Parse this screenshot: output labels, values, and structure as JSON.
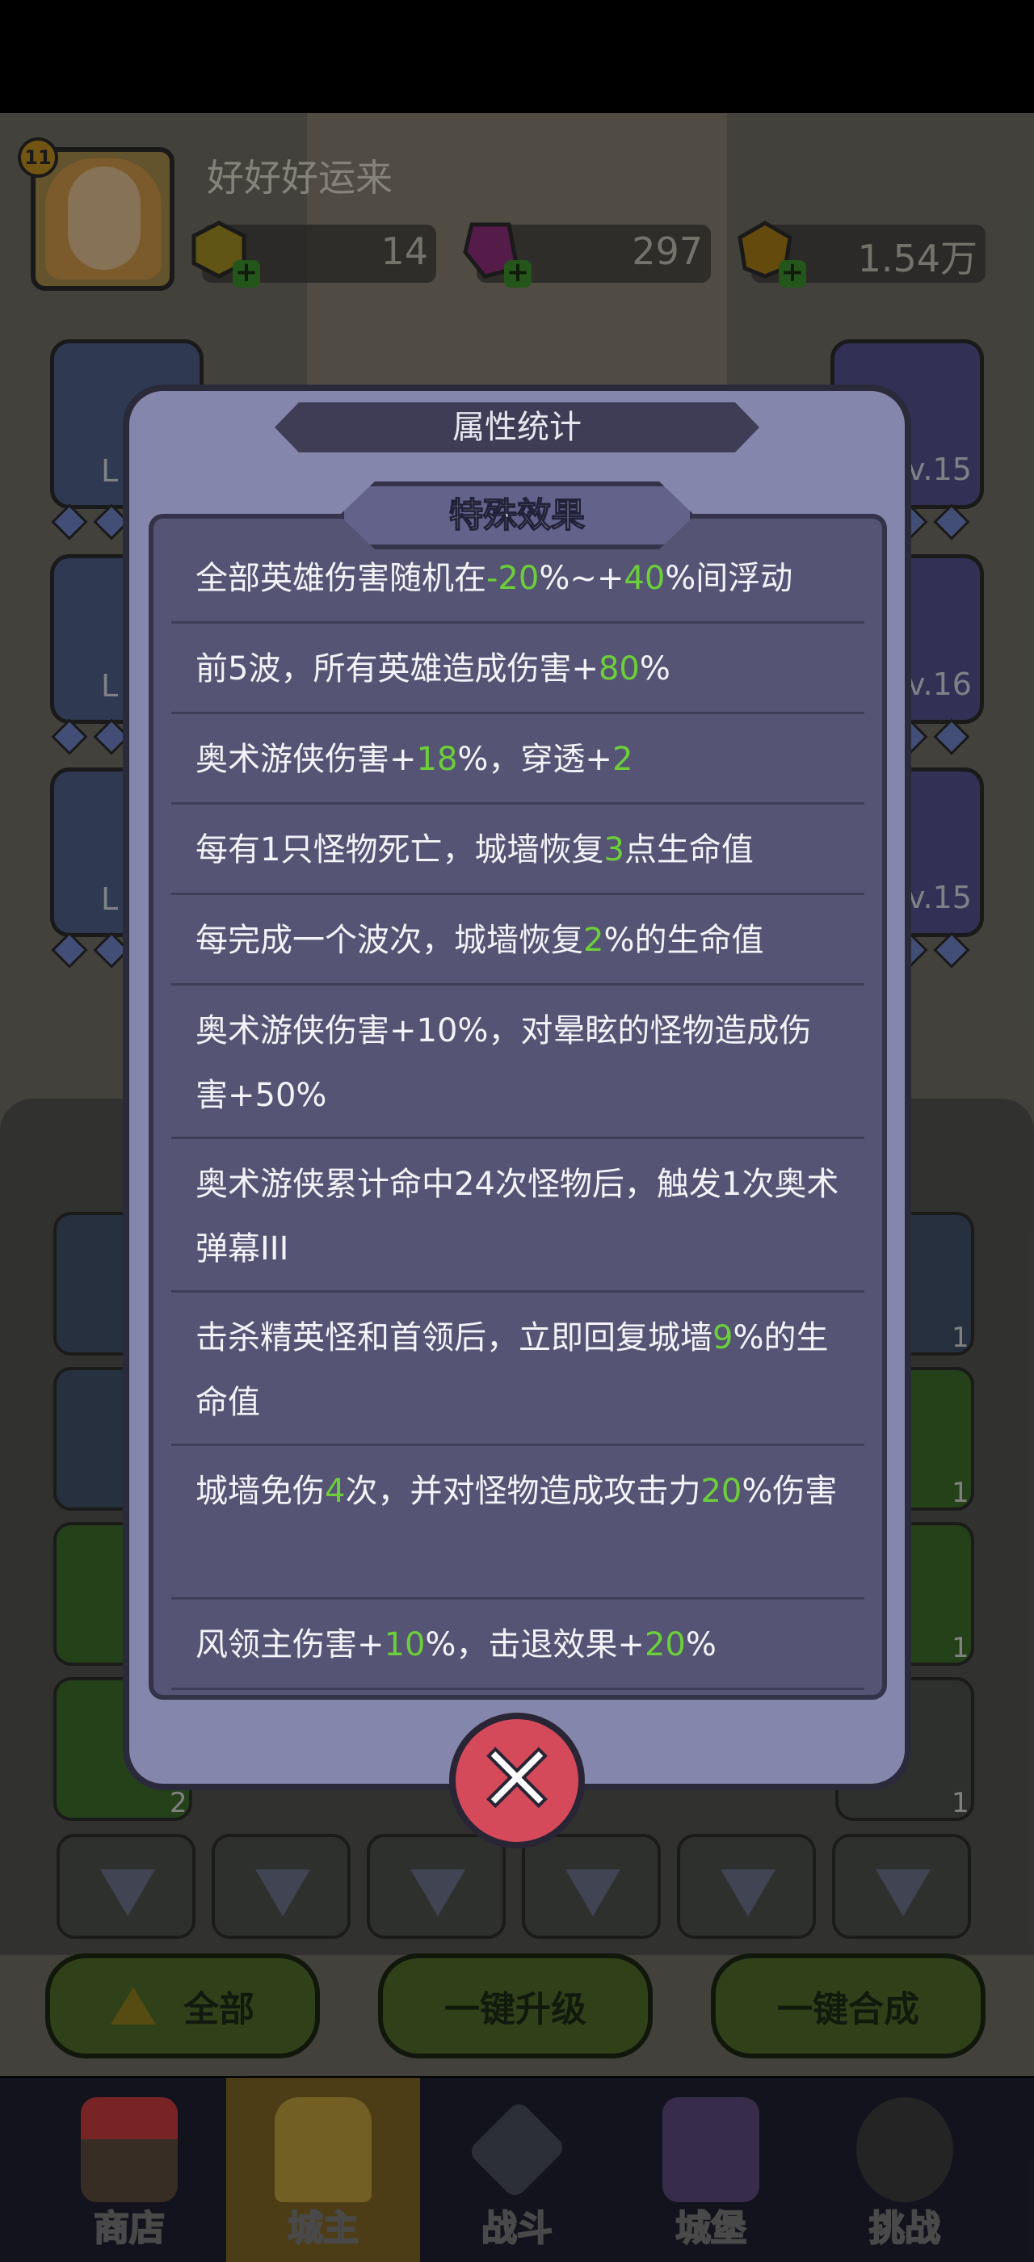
{
  "player": {
    "level": "11",
    "name": "好好好运来"
  },
  "resources": [
    {
      "name": "energy",
      "value": "14"
    },
    {
      "name": "gem",
      "value": "297"
    },
    {
      "name": "gold",
      "value": "1.54万"
    }
  ],
  "side_slots": {
    "left": [
      {
        "level": "L"
      },
      {
        "level": "L"
      },
      {
        "level": "L"
      }
    ],
    "right": [
      {
        "level": "v.15"
      },
      {
        "level": "v.16"
      },
      {
        "level": "v.15"
      }
    ]
  },
  "inventory": {
    "counts": [
      "1",
      "1",
      "1",
      "1",
      "2",
      "1",
      "1",
      "1",
      "1"
    ]
  },
  "bottom_buttons": {
    "all": "全部",
    "upgrade": "一键升级",
    "merge": "一键合成"
  },
  "tabs": [
    {
      "label": "商店",
      "icon": "shop-icon"
    },
    {
      "label": "城主",
      "icon": "crown-icon",
      "active": true
    },
    {
      "label": "战斗",
      "icon": "swords-icon"
    },
    {
      "label": "城堡",
      "icon": "castle-icon"
    },
    {
      "label": "挑战",
      "icon": "demon-icon"
    }
  ],
  "dialog": {
    "title": "属性统计",
    "section": "特殊效果",
    "effects": [
      [
        {
          "t": "全部英雄伤害随机在"
        },
        {
          "t": "-20",
          "g": true
        },
        {
          "t": "%~+"
        },
        {
          "t": "40",
          "g": true
        },
        {
          "t": "%间浮动"
        }
      ],
      [
        {
          "t": "前5波，所有英雄造成伤害+"
        },
        {
          "t": "80",
          "g": true
        },
        {
          "t": "%"
        }
      ],
      [
        {
          "t": "奥术游侠伤害+"
        },
        {
          "t": "18",
          "g": true
        },
        {
          "t": "%，穿透+"
        },
        {
          "t": "2",
          "g": true
        }
      ],
      [
        {
          "t": "每有1只怪物死亡，城墙恢复"
        },
        {
          "t": "3",
          "g": true
        },
        {
          "t": "点生命值"
        }
      ],
      [
        {
          "t": "每完成一个波次，城墙恢复"
        },
        {
          "t": "2",
          "g": true
        },
        {
          "t": "%的生命值"
        }
      ],
      [
        {
          "t": "奥术游侠伤害+10%，对晕眩的怪物造成伤害+50%"
        }
      ],
      [
        {
          "t": "奥术游侠累计命中24次怪物后，触发1次奥术弹幕III"
        }
      ],
      [
        {
          "t": "击杀精英怪和首领后，立即回复城墙"
        },
        {
          "t": "9",
          "g": true
        },
        {
          "t": "%的生命值"
        }
      ],
      [
        {
          "t": "城墙免伤"
        },
        {
          "t": "4",
          "g": true
        },
        {
          "t": "次，并对怪物造成攻击力"
        },
        {
          "t": "20",
          "g": true
        },
        {
          "t": "%伤害"
        }
      ],
      [
        {
          "t": "风领主伤害+"
        },
        {
          "t": "10",
          "g": true
        },
        {
          "t": "%，击退效果+"
        },
        {
          "t": "20",
          "g": true
        },
        {
          "t": "%"
        }
      ]
    ],
    "close_icon": "close-icon"
  },
  "colors": {
    "highlight": "#6ccf3a",
    "dialog_bg": "#8586ac",
    "panel_bg": "#555474",
    "close": "#d44a5a"
  }
}
